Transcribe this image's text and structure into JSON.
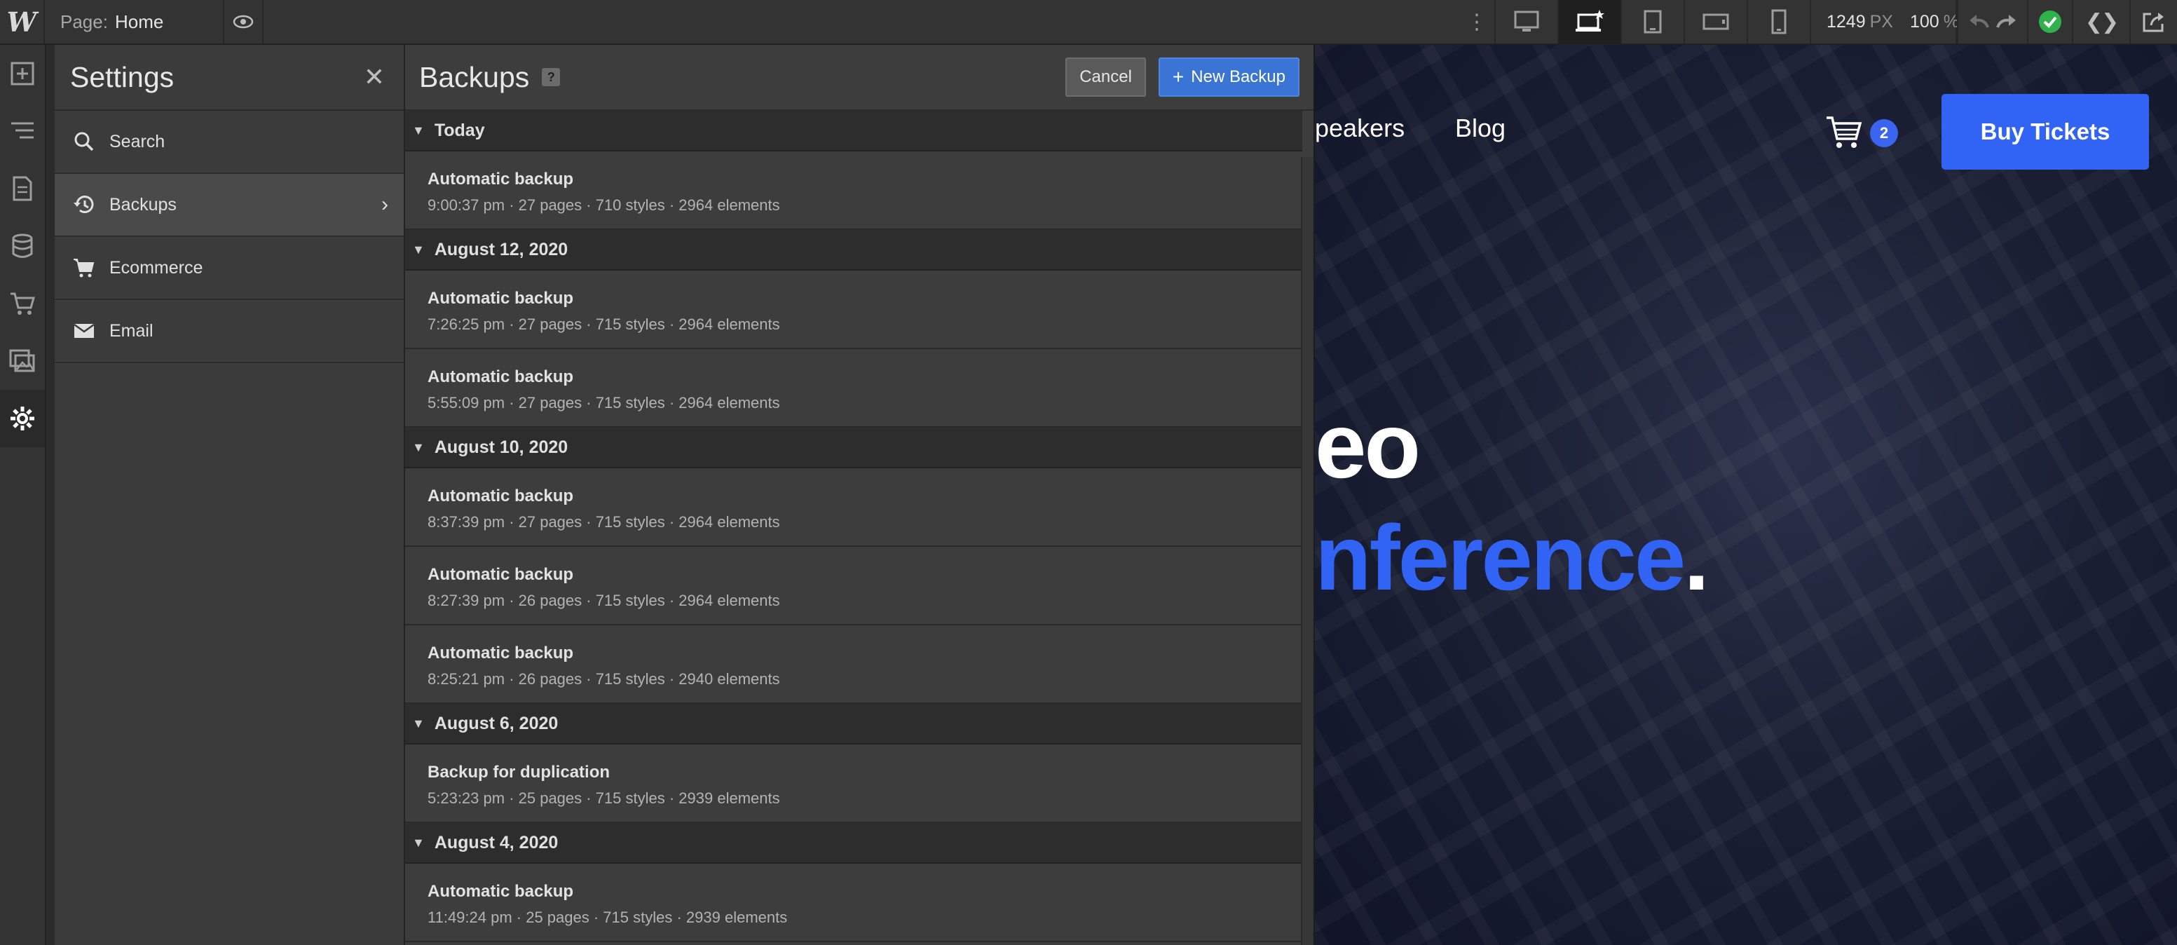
{
  "topbar": {
    "logo": "W",
    "page_label": "Page:",
    "page_name": "Home",
    "kebab": "⋮",
    "width_value": "1249",
    "width_unit": "PX",
    "zoom_value": "100",
    "zoom_unit": "%",
    "code_symbol": "❮❯"
  },
  "settings": {
    "title": "Settings",
    "close": "✕",
    "items": [
      {
        "label": "Search",
        "icon": "search-icon"
      },
      {
        "label": "Backups",
        "icon": "history-icon",
        "chevron": "›"
      },
      {
        "label": "Ecommerce",
        "icon": "cart-icon"
      },
      {
        "label": "Email",
        "icon": "envelope-icon"
      }
    ]
  },
  "backups": {
    "title": "Backups",
    "help": "?",
    "cancel": "Cancel",
    "new_plus": "+",
    "new_backup": "New Backup",
    "groups": [
      {
        "label": "Today",
        "entries": [
          {
            "title": "Automatic backup",
            "meta": "9:00:37 pm · 27 pages · 710 styles · 2964 elements"
          }
        ]
      },
      {
        "label": "August 12, 2020",
        "entries": [
          {
            "title": "Automatic backup",
            "meta": "7:26:25 pm · 27 pages · 715 styles · 2964 elements"
          },
          {
            "title": "Automatic backup",
            "meta": "5:55:09 pm · 27 pages · 715 styles · 2964 elements"
          }
        ]
      },
      {
        "label": "August 10, 2020",
        "entries": [
          {
            "title": "Automatic backup",
            "meta": "8:37:39 pm · 27 pages · 715 styles · 2964 elements"
          },
          {
            "title": "Automatic backup",
            "meta": "8:27:39 pm · 26 pages · 715 styles · 2964 elements"
          },
          {
            "title": "Automatic backup",
            "meta": "8:25:21 pm · 26 pages · 715 styles · 2940 elements"
          }
        ]
      },
      {
        "label": "August 6, 2020",
        "entries": [
          {
            "title": "Backup for duplication",
            "meta": "5:23:23 pm · 25 pages · 715 styles · 2939 elements"
          }
        ]
      },
      {
        "label": "August 4, 2020",
        "entries": [
          {
            "title": "Automatic backup",
            "meta": "11:49:24 pm · 25 pages · 715 styles · 2939 elements"
          }
        ]
      }
    ]
  },
  "canvas": {
    "nav_speakers": "peakers",
    "nav_blog": "Blog",
    "cart_count": "2",
    "buy_tickets": "Buy Tickets",
    "hero_line1": "eo",
    "hero_line2": "nference",
    "hero_dot": ".",
    "colors": {
      "accent": "#3164f4",
      "status_ok": "#2fb24a",
      "primary_button": "#3a74d4"
    }
  }
}
